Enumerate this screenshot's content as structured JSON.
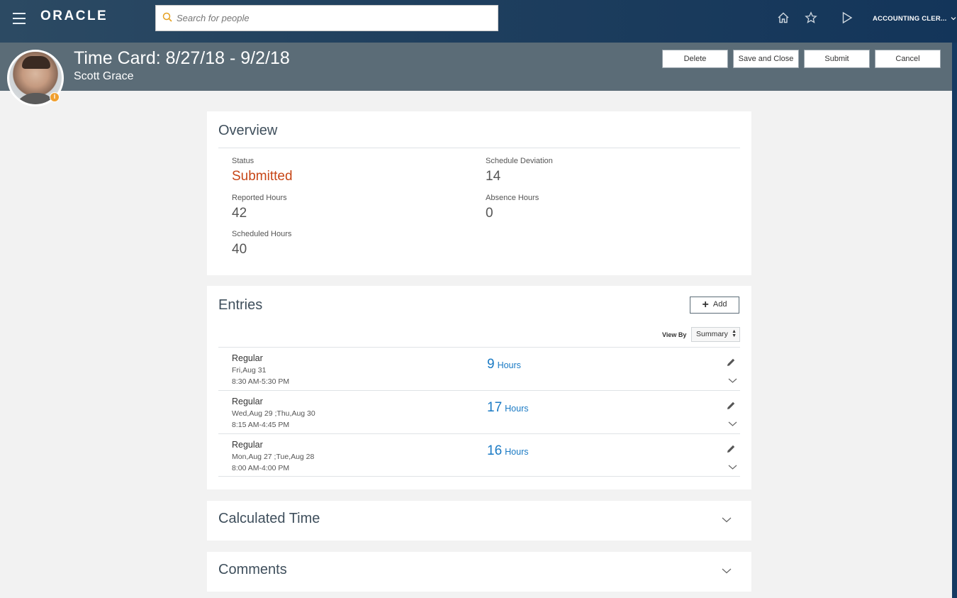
{
  "topbar": {
    "logo": "ORACLE",
    "search_placeholder": "Search for people",
    "user_label": "ACCOUNTING CLER..."
  },
  "header": {
    "title": "Time Card: 8/27/18 - 9/2/18",
    "person": "Scott Grace",
    "avatar_badge": "i",
    "buttons": {
      "delete": "Delete",
      "save_close": "Save and Close",
      "submit": "Submit",
      "cancel": "Cancel"
    }
  },
  "overview": {
    "title": "Overview",
    "status_label": "Status",
    "status_value": "Submitted",
    "reported_label": "Reported Hours",
    "reported_value": "42",
    "scheduled_label": "Scheduled Hours",
    "scheduled_value": "40",
    "deviation_label": "Schedule Deviation",
    "deviation_value": "14",
    "absence_label": "Absence Hours",
    "absence_value": "0"
  },
  "entries": {
    "title": "Entries",
    "add_label": "Add",
    "view_by_label": "View By",
    "view_by_value": "Summary",
    "items": [
      {
        "type": "Regular",
        "dates": "Fri,Aug 31",
        "time": "8:30 AM-5:30 PM",
        "hours": "9",
        "unit": "Hours"
      },
      {
        "type": "Regular",
        "dates": "Wed,Aug 29 ;Thu,Aug 30",
        "time": "8:15 AM-4:45 PM",
        "hours": "17",
        "unit": "Hours"
      },
      {
        "type": "Regular",
        "dates": "Mon,Aug 27 ;Tue,Aug 28",
        "time": "8:00 AM-4:00 PM",
        "hours": "16",
        "unit": "Hours"
      }
    ]
  },
  "calculated": {
    "title": "Calculated Time"
  },
  "comments": {
    "title": "Comments"
  },
  "colors": {
    "status": "#c74617",
    "link": "#1a7ac4",
    "header_band": "#5b6c77",
    "topbar": "#1f3f5e"
  }
}
